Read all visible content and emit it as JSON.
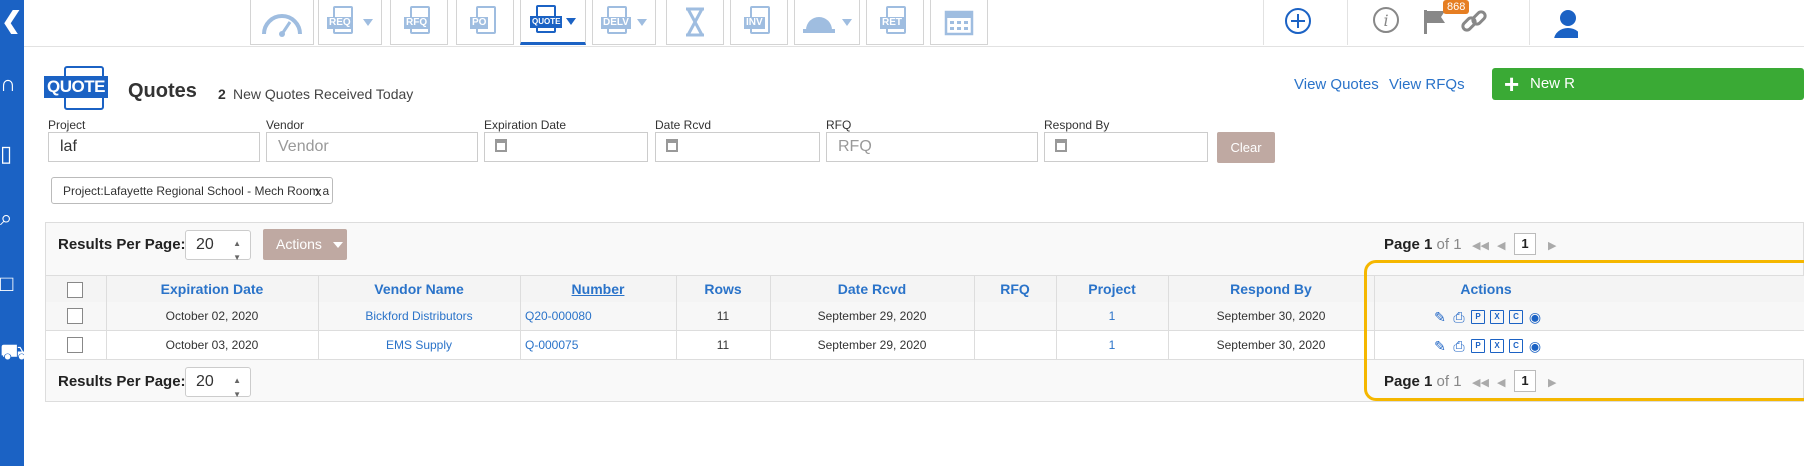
{
  "nav": {
    "tabs": [
      {
        "label": "",
        "icon": "speedometer-icon",
        "caret": false
      },
      {
        "label": "REQ",
        "icon": "document-icon",
        "caret": true
      },
      {
        "label": "RFQ",
        "icon": "document-icon",
        "caret": false
      },
      {
        "label": "PO",
        "icon": "document-icon",
        "caret": false
      },
      {
        "label": "QUOTE",
        "icon": "document-icon",
        "caret": true,
        "active": true
      },
      {
        "label": "DELV",
        "icon": "document-icon",
        "caret": true
      },
      {
        "label": "",
        "icon": "hourglass-icon",
        "caret": false
      },
      {
        "label": "INV",
        "icon": "document-icon",
        "caret": false
      },
      {
        "label": "",
        "icon": "hardhat-icon",
        "caret": true
      },
      {
        "label": "RET",
        "icon": "document-icon",
        "caret": false
      },
      {
        "label": "",
        "icon": "calendar-icon",
        "caret": false
      }
    ],
    "flag_badge": "868",
    "accent": "#1b62c4"
  },
  "header": {
    "logo_label": "QUOTE",
    "title": "Quotes",
    "new_count": "2",
    "new_text": "New Quotes Received Today",
    "view_quotes": "View Quotes",
    "view_rfqs": "View RFQs",
    "new_button": "New R"
  },
  "filters": {
    "project_label": "Project",
    "project_value": "laf",
    "vendor_label": "Vendor",
    "vendor_placeholder": "Vendor",
    "expiration_label": "Expiration Date",
    "date_rcvd_label": "Date Rcvd",
    "rfq_label": "RFQ",
    "rfq_placeholder": "RFQ",
    "respond_by_label": "Respond By",
    "clear_label": "Clear",
    "active_tag": "Project:Lafayette Regional School - Mech Room a",
    "tag_close": "x"
  },
  "grid": {
    "results_per_page_label": "Results Per Page:",
    "results_per_page": "20",
    "actions_label": "Actions",
    "page_label": "Page",
    "page_current": "1",
    "page_of": "of 1",
    "page_box": "1",
    "columns": [
      "Expiration Date",
      "Vendor Name",
      "Number",
      "Rows",
      "Date Rcvd",
      "RFQ",
      "Project",
      "Respond By",
      "Actions"
    ],
    "rows": [
      {
        "expiration": "October 02, 2020",
        "vendor": "Bickford Distributors",
        "number": "Q20-000080",
        "rows": "11",
        "date_rcvd": "September 29, 2020",
        "rfq": "",
        "project": "1",
        "respond_by": "September 30, 2020"
      },
      {
        "expiration": "October 03, 2020",
        "vendor": "EMS Supply",
        "number": "Q-000075",
        "rows": "11",
        "date_rcvd": "September 29, 2020",
        "rfq": "",
        "project": "1",
        "respond_by": "September 30, 2020"
      }
    ],
    "row_action_icons": [
      "edit-icon",
      "print-icon",
      "pdf-icon",
      "excel-icon",
      "csv-icon",
      "camera-icon"
    ]
  }
}
